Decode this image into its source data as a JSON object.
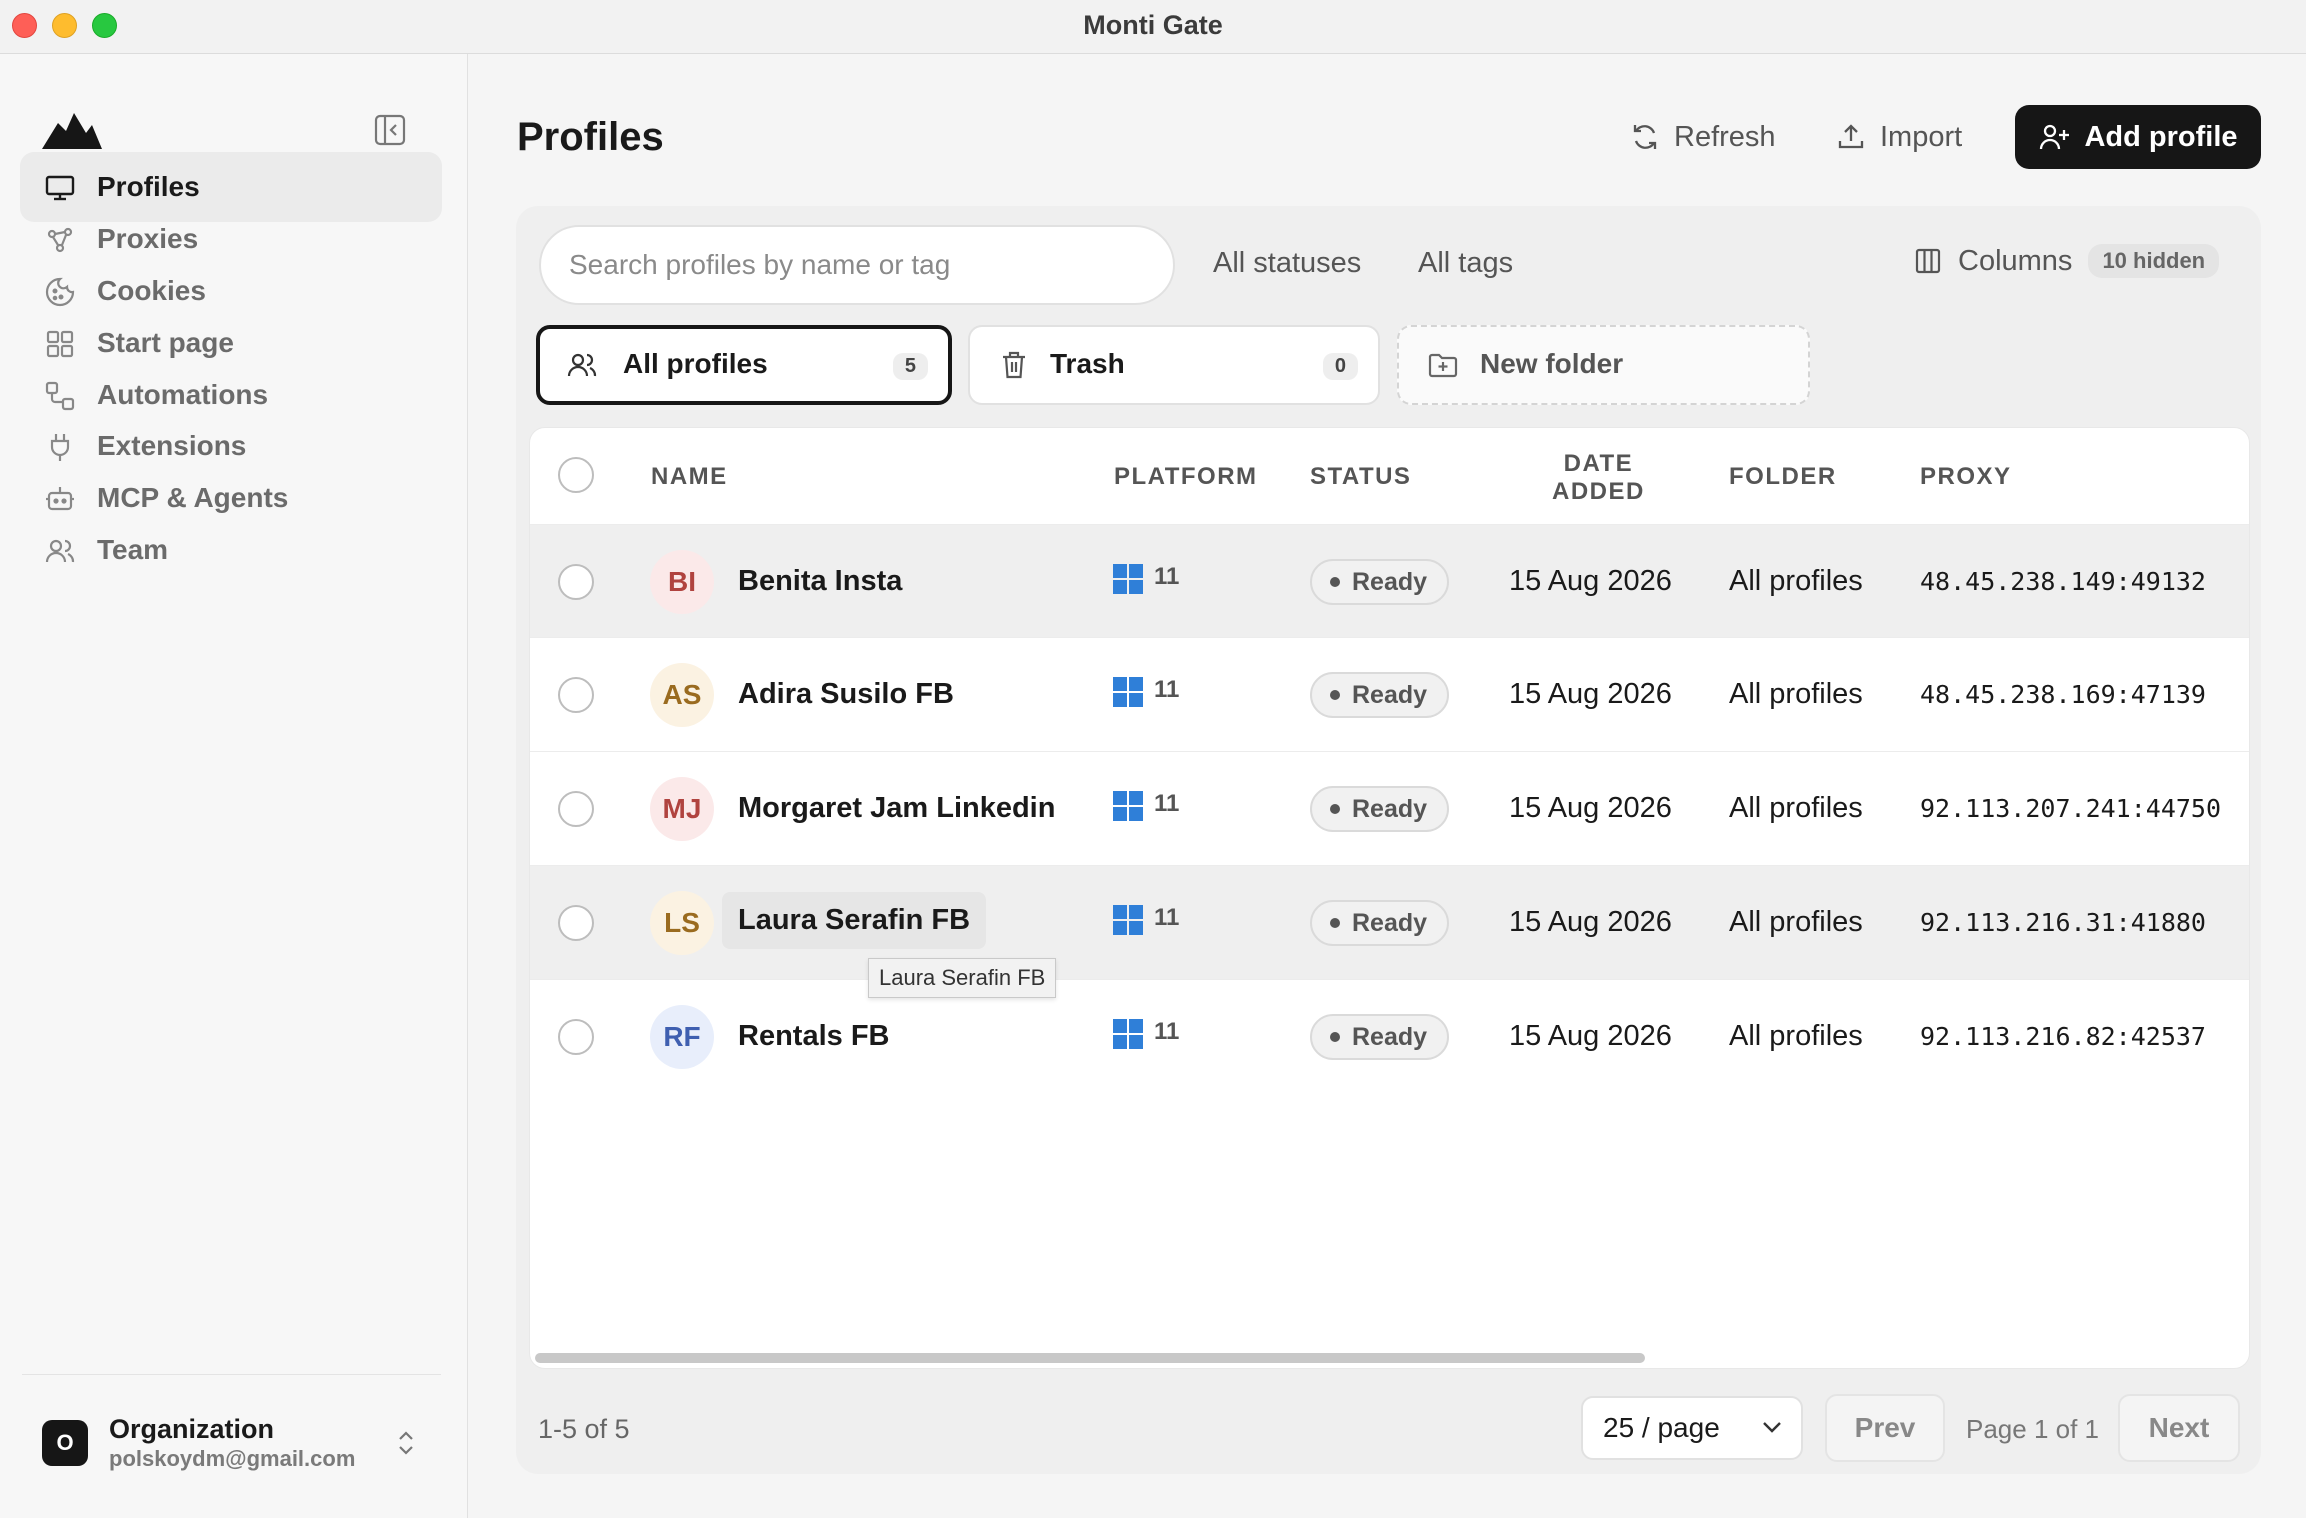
{
  "window": {
    "title": "Monti Gate"
  },
  "sidebar": {
    "items": [
      {
        "label": "Profiles",
        "icon": "monitor-icon",
        "active": true
      },
      {
        "label": "Proxies",
        "icon": "proxy-network-icon"
      },
      {
        "label": "Cookies",
        "icon": "cookie-icon"
      },
      {
        "label": "Start page",
        "icon": "grid-icon"
      },
      {
        "label": "Automations",
        "icon": "workflow-icon"
      },
      {
        "label": "Extensions",
        "icon": "plug-icon"
      },
      {
        "label": "MCP & Agents",
        "icon": "bot-icon"
      },
      {
        "label": "Team",
        "icon": "users-icon"
      }
    ],
    "org": {
      "initial": "O",
      "name": "Organization",
      "email": "polskoydm@gmail.com"
    }
  },
  "header": {
    "title": "Profiles",
    "refresh_label": "Refresh",
    "import_label": "Import",
    "add_label": "Add profile"
  },
  "toolbar": {
    "search_placeholder": "Search profiles by name or tag",
    "status_filter": "All statuses",
    "tag_filter": "All tags",
    "columns_label": "Columns",
    "hidden_badge": "10 hidden"
  },
  "folders": [
    {
      "label": "All profiles",
      "count": "5",
      "active": true
    },
    {
      "label": "Trash",
      "count": "0"
    },
    {
      "label": "New folder"
    }
  ],
  "table": {
    "columns": [
      "NAME",
      "PLATFORM",
      "STATUS",
      "DATE",
      "ADDED",
      "FOLDER",
      "PROXY"
    ],
    "rows": [
      {
        "initials": "BI",
        "name": "Benita Insta",
        "platform": "11",
        "status": "Ready",
        "date": "15 Aug 2026",
        "folder": "All profiles",
        "proxy": "48.45.238.149:49132"
      },
      {
        "initials": "AS",
        "name": "Adira Susilo FB",
        "platform": "11",
        "status": "Ready",
        "date": "15 Aug 2026",
        "folder": "All profiles",
        "proxy": "48.45.238.169:47139"
      },
      {
        "initials": "MJ",
        "name": "Morgaret Jam Linkedin",
        "platform": "11",
        "status": "Ready",
        "date": "15 Aug 2026",
        "folder": "All profiles",
        "proxy": "92.113.207.241:44750"
      },
      {
        "initials": "LS",
        "name": "Laura Serafin FB",
        "platform": "11",
        "status": "Ready",
        "date": "15 Aug 2026",
        "folder": "All profiles",
        "proxy": "92.113.216.31:41880"
      },
      {
        "initials": "RF",
        "name": "Rentals FB",
        "platform": "11",
        "status": "Ready",
        "date": "15 Aug 2026",
        "folder": "All profiles",
        "proxy": "92.113.216.82:42537"
      }
    ],
    "tooltip": "Laura Serafin FB"
  },
  "footer": {
    "range": "1-5 of 5",
    "page_size": "25 / page",
    "prev_label": "Prev",
    "page_indicator": "Page 1 of 1",
    "next_label": "Next"
  },
  "colors": {
    "accent": "#161616",
    "avatar_red_bg": "#fbe9e9",
    "avatar_red_fg": "#b0433f",
    "avatar_yellow_bg": "#fbf2e2",
    "avatar_yellow_fg": "#9a6b1f",
    "avatar_blue_bg": "#e8eefb",
    "avatar_blue_fg": "#3f5fb0",
    "windows_blue": "#2f7fd8"
  }
}
